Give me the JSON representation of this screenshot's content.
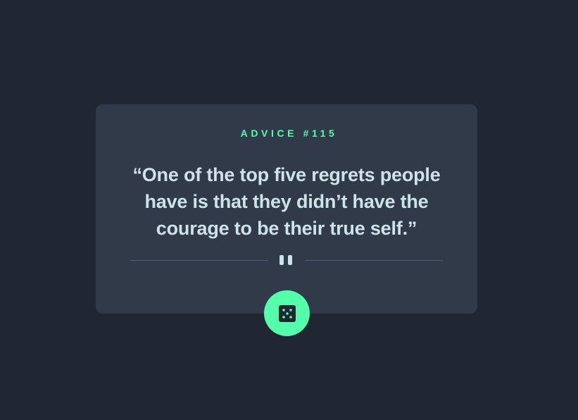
{
  "advice": {
    "id_label": "ADVICE #115",
    "quote": "“One of the top five regrets people have is that they didn’t have the courage to be their true self.”"
  },
  "divider": {
    "icon": "pause-icon"
  },
  "action": {
    "icon": "dice-icon",
    "accent_color": "#53ffaa"
  },
  "colors": {
    "background": "#202733",
    "card": "#313a48",
    "text": "#cee3e9",
    "accent": "#53ffaa",
    "divider": "#4f5d74"
  }
}
